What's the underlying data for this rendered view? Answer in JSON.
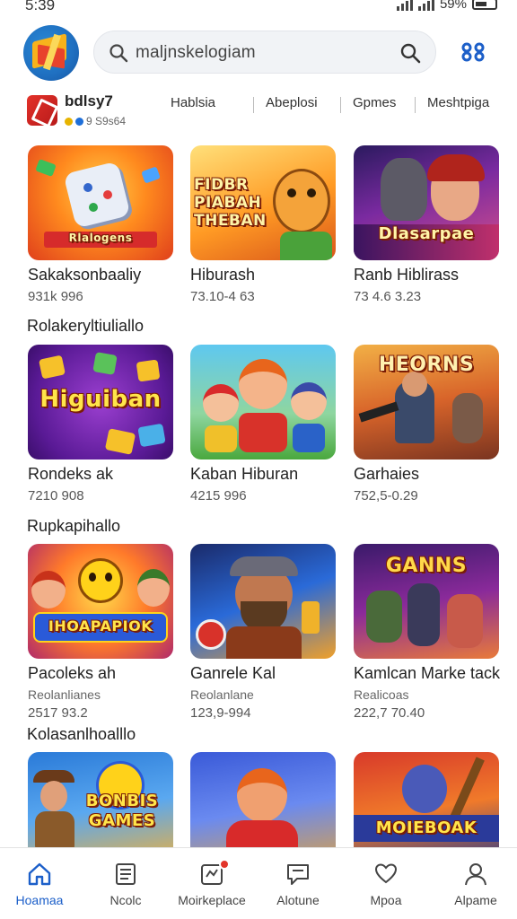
{
  "status": {
    "time": "5:39",
    "battery": "59%"
  },
  "header": {
    "search_text": "maljnskelogiam",
    "icons": {
      "search": "search-icon",
      "submit": "search-icon",
      "action": "scan-icon"
    }
  },
  "subnav": {
    "dev_name": "bdlsy7",
    "dev_meta": "9 S9s64",
    "tabs": [
      "Hablsia",
      "Abeplosi",
      "Gpmes",
      "Meshtpiga"
    ]
  },
  "sections": [
    {
      "title": ""
    },
    {
      "title": "Rolakeryltiuliallo"
    },
    {
      "title": "Rupkapihallo"
    },
    {
      "title": "Kolasanlhoalllo"
    }
  ],
  "cards": [
    {
      "title": "Sakaksonbaaliy",
      "meta": "931k 996",
      "thumb_text": "Rlalogens",
      "theme": "orange-dice"
    },
    {
      "title": "Hiburash",
      "meta": "73.10-4 63",
      "thumb_text": "FIDBR PIABAH THEBAN",
      "theme": "bear"
    },
    {
      "title": "Ranb Hiblirass",
      "meta": "73 4.6 3.23",
      "thumb_text": "Dlasarpae",
      "theme": "wolf"
    },
    {
      "title": "Rondeks ak",
      "meta": "7210 908",
      "thumb_text": "Higuiban",
      "theme": "purple-tiles"
    },
    {
      "title": "Kaban Hiburan",
      "meta": "4215 996",
      "thumb_text": "",
      "theme": "cartoon-kids"
    },
    {
      "title": "Garhaies",
      "meta": "752,5-0.29",
      "thumb_text": "HEORNS",
      "theme": "fighters"
    },
    {
      "title": "Pacoleks ah",
      "sub": "Reolanlianes",
      "meta": "2517 93.2",
      "thumb_text": "IHOAPAPIOK",
      "theme": "smiley"
    },
    {
      "title": "Ganrele Kal",
      "sub": "Reolanlane",
      "meta": "123,9-994",
      "thumb_text": "",
      "theme": "viking"
    },
    {
      "title": "Kamlcan Marke tack",
      "sub": "Realicoas",
      "meta": "222,7 70.40",
      "thumb_text": "GANNS",
      "theme": "orc-battle"
    },
    {
      "title": "",
      "meta": "",
      "thumb_text": "BONBIS GAMES",
      "theme": "cowboy"
    },
    {
      "title": "",
      "meta": "",
      "thumb_text": "",
      "theme": "hero"
    },
    {
      "title": "",
      "meta": "",
      "thumb_text": "MOIEBOAK",
      "theme": "guitar"
    }
  ],
  "bottom_nav": [
    {
      "label": "Hoamaa",
      "icon": "home-icon",
      "active": true
    },
    {
      "label": "Ncolc",
      "icon": "document-icon",
      "active": false
    },
    {
      "label": "Moirkeplace",
      "icon": "marketplace-icon",
      "active": false,
      "badge": true
    },
    {
      "label": "Alotune",
      "icon": "chat-icon",
      "active": false
    },
    {
      "label": "Mpoa",
      "icon": "heart-hand-icon",
      "active": false
    },
    {
      "label": "Alpame",
      "icon": "profile-icon",
      "active": false
    }
  ],
  "colors": {
    "accent": "#1c5fc9",
    "badge": "#e2352a"
  }
}
